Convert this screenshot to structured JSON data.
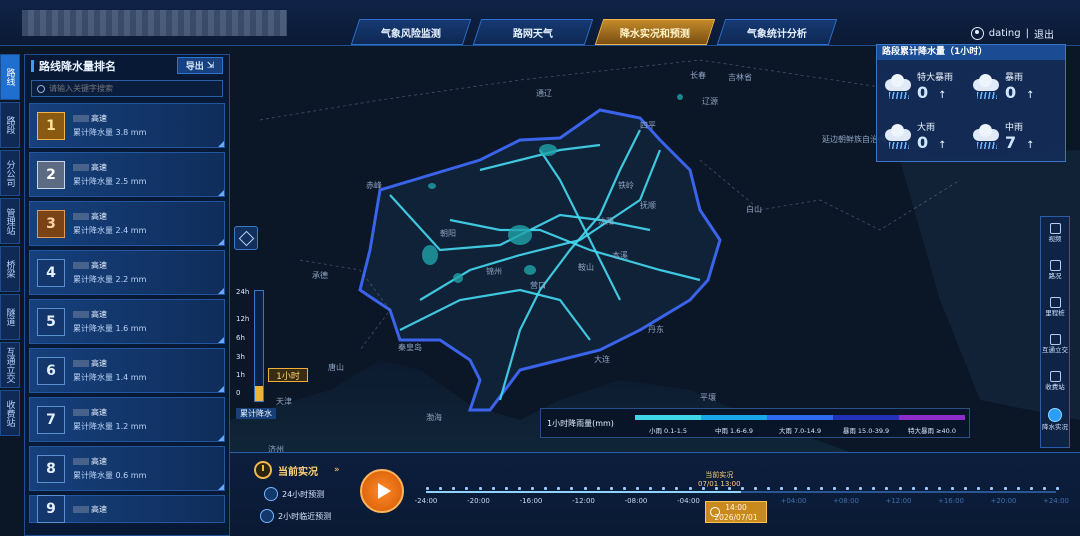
{
  "header": {
    "nav_tabs": [
      {
        "label": "气象风险监测",
        "active": false
      },
      {
        "label": "路网天气",
        "active": false
      },
      {
        "label": "降水实况和预测",
        "active": true
      },
      {
        "label": "气象统计分析",
        "active": false
      }
    ],
    "user": {
      "name": "dating",
      "separator": "|",
      "logout": "退出"
    }
  },
  "side_tabs": [
    {
      "label": "路线",
      "active": true
    },
    {
      "label": "路段",
      "active": false
    },
    {
      "label": "分公司",
      "active": false
    },
    {
      "label": "管理站",
      "active": false
    },
    {
      "label": "桥梁",
      "active": false
    },
    {
      "label": "隧道",
      "active": false
    },
    {
      "label": "互通立交",
      "active": false
    },
    {
      "label": "收费站",
      "active": false
    }
  ],
  "ranking": {
    "title": "路线降水量排名",
    "export_label": "导出",
    "search_placeholder": "请输入关键字搜索",
    "items": [
      {
        "rank": "1",
        "name": "高速",
        "value": "累计降水量 3.8 mm",
        "medal": "gold"
      },
      {
        "rank": "2",
        "name": "高速",
        "value": "累计降水量 2.5 mm",
        "medal": "silver"
      },
      {
        "rank": "3",
        "name": "高速",
        "value": "累计降水量 2.4 mm",
        "medal": "bronze"
      },
      {
        "rank": "4",
        "name": "高速",
        "value": "累计降水量 2.2 mm",
        "medal": "none"
      },
      {
        "rank": "5",
        "name": "高速",
        "value": "累计降水量 1.6 mm",
        "medal": "none"
      },
      {
        "rank": "6",
        "name": "高速",
        "value": "累计降水量 1.4 mm",
        "medal": "none"
      },
      {
        "rank": "7",
        "name": "高速",
        "value": "累计降水量 1.2 mm",
        "medal": "none"
      },
      {
        "rank": "8",
        "name": "高速",
        "value": "累计降水量 0.6 mm",
        "medal": "none"
      },
      {
        "rank": "9",
        "name": "高速",
        "value": "",
        "medal": "none"
      }
    ]
  },
  "rain_summary": {
    "title": "路段累计降水量（1小时）",
    "items": [
      {
        "label": "特大暴雨",
        "count": "0",
        "trend": "↑"
      },
      {
        "label": "暴雨",
        "count": "0",
        "trend": "↑"
      },
      {
        "label": "大雨",
        "count": "0",
        "trend": "↑"
      },
      {
        "label": "中雨",
        "count": "7",
        "trend": "↑"
      }
    ]
  },
  "right_toolbar": [
    {
      "label": "视频",
      "icon": "camera-icon",
      "active": false
    },
    {
      "label": "路况",
      "icon": "traffic-light-icon",
      "active": false
    },
    {
      "label": "里程桩",
      "icon": "milestone-icon",
      "active": false
    },
    {
      "label": "互通立交",
      "icon": "interchange-icon",
      "active": false
    },
    {
      "label": "收费站",
      "icon": "toll-station-icon",
      "active": false
    },
    {
      "label": "降水实况",
      "icon": "rain-icon",
      "active": true
    }
  ],
  "time_scale": {
    "ticks": [
      "24h",
      "12h",
      "6h",
      "3h",
      "1h",
      "0"
    ],
    "selected": "1小时",
    "caption": "累计降水",
    "fill_fraction": 0.14
  },
  "legend": {
    "title": "1小时降雨量(mm)",
    "segments": [
      {
        "label": "小雨 0.1-1.5",
        "color": "#3fd7e6",
        "weight": 1
      },
      {
        "label": "中雨 1.6-6.9",
        "color": "#1aa7e8",
        "weight": 1
      },
      {
        "label": "大雨 7.0-14.9",
        "color": "#2d6bf0",
        "weight": 1
      },
      {
        "label": "暴雨 15.0-39.9",
        "color": "#2231b8",
        "weight": 1
      },
      {
        "label": "特大暴雨 ≥40.0",
        "color": "#8e2cc9",
        "weight": 1
      }
    ]
  },
  "map_labels": [
    "长春",
    "通辽",
    "吉林省",
    "四平",
    "辽源",
    "赤峰",
    "铁岭",
    "沈阳",
    "本溪",
    "白山",
    "朝阳",
    "抚顺",
    "承德",
    "锦州",
    "营口",
    "秦皇岛",
    "唐山",
    "鞍山",
    "天津",
    "渤海",
    "大连",
    "丹东",
    "平壤",
    "济州",
    "延边朝鲜族自治州"
  ],
  "bottom": {
    "mode_main": "当前实况",
    "mode_24h": "24小时预测",
    "mode_2h": "2小时临近预测",
    "timeline_ticks": [
      "-24:00",
      "-20:00",
      "-16:00",
      "-12:00",
      "-08:00",
      "-04:00",
      "+04:00",
      "+08:00",
      "+12:00",
      "+16:00",
      "+20:00",
      "+24:00"
    ],
    "now_label": "当前实况",
    "now_time": "07/01 13:00",
    "cursor_time": "14:00",
    "cursor_date": "2026/07/01",
    "progress_fraction": 0.5
  }
}
